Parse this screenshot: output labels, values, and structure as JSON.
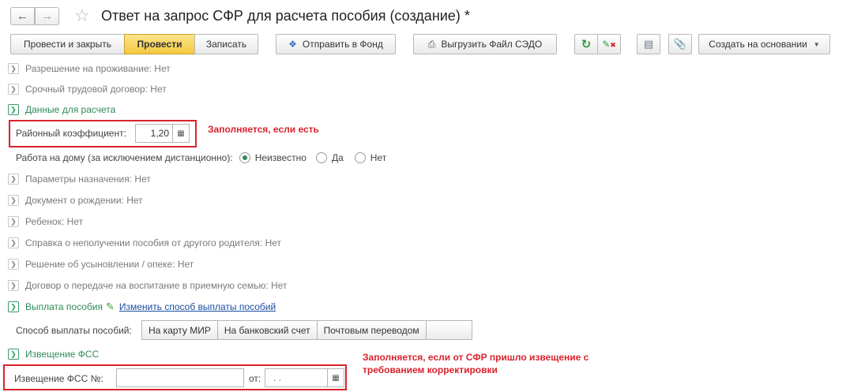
{
  "window": {
    "title": "Ответ на запрос СФР для расчета пособия (создание) *"
  },
  "toolbar": {
    "post_and_close": "Провести и закрыть",
    "post": "Провести",
    "save": "Записать",
    "send_to_fund": "Отправить в Фонд",
    "export_sedo": "Выгрузить Файл СЭДО",
    "create_based_on": "Создать на основании"
  },
  "sections": {
    "residence_permit": "Разрешение на проживание: Нет",
    "fixed_term_contract": "Срочный трудовой договор: Нет",
    "calc_data": "Данные для расчета",
    "assignment_params": "Параметры назначения: Нет",
    "birth_document": "Документ о рождении: Нет",
    "child": "Ребенок: Нет",
    "non_receipt_certificate": "Справка о неполучении пособия от другого родителя: Нет",
    "adoption_decision": "Решение об усыновлении / опеке: Нет",
    "foster_contract": "Договор о передаче на воспитание в приемную семью: Нет",
    "benefit_payment": "Выплата пособия",
    "change_payment_method": "Изменить способ выплаты пособий",
    "fss_notice_section": "Извещение ФСС"
  },
  "fields": {
    "regional_coef_label": "Районный коэффициент:",
    "regional_coef_value": "1,20",
    "home_work_label": "Работа на дому (за исключением дистанционно):",
    "home_work_options": [
      "Неизвестно",
      "Да",
      "Нет"
    ],
    "home_work_selected": "Неизвестно",
    "payment_method_label": "Способ выплаты пособий:",
    "payment_methods": [
      "На карту МИР",
      "На банковский счет",
      "Почтовым переводом"
    ],
    "fss_notice_label": "Извещение ФСС №:",
    "fss_notice_value": "",
    "date_label": "от:",
    "date_value": " .  ."
  },
  "annotations": {
    "coef_note": "Заполняется, если есть",
    "notice_note_line1": "Заполняется, если от СФР пришло извещение с",
    "notice_note_line2": "требованием корректировки"
  },
  "colors": {
    "accent_yellow": "#f3c93f",
    "annotation_red": "#d9232d",
    "section_green": "#2e8b57",
    "link_blue": "#1a4fa0"
  }
}
